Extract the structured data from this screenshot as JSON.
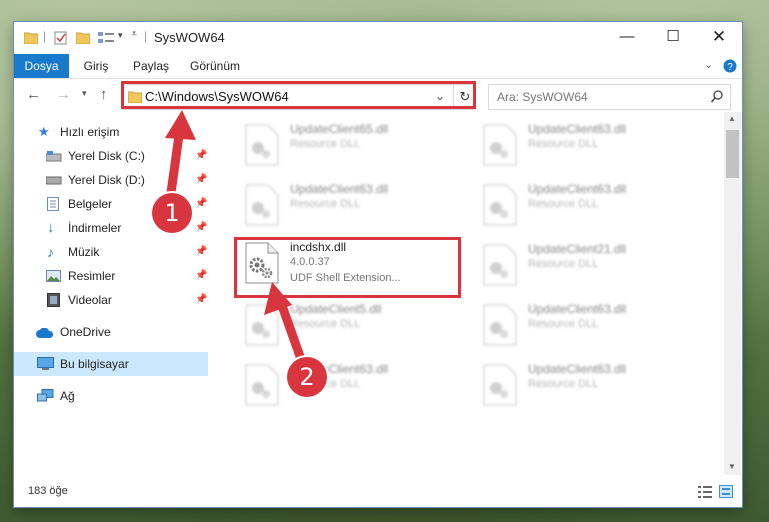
{
  "window": {
    "title": "SysWOW64"
  },
  "ribbon": {
    "tabs": [
      "Dosya",
      "Giriş",
      "Paylaş",
      "Görünüm"
    ]
  },
  "address": {
    "path": "C:\\Windows\\SysWOW64"
  },
  "search": {
    "placeholder": "Ara: SysWOW64"
  },
  "sidebar": {
    "quick_access": "Hızlı erişim",
    "items": [
      "Yerel Disk (C:)",
      "Yerel Disk (D:)",
      "Belgeler",
      "İndirmeler",
      "Müzik",
      "Resimler",
      "Videolar"
    ],
    "onedrive": "OneDrive",
    "this_pc": "Bu bilgisayar",
    "network": "Ağ"
  },
  "files": {
    "left": [
      {
        "name": "UpdateClient65.dll",
        "desc": "Resource DLL"
      },
      {
        "name": "UpdateClient63.dll",
        "desc": "Resource DLL"
      },
      {
        "name": "incdshx.dll",
        "version": "4.0.0.37",
        "desc": "UDF Shell Extension..."
      },
      {
        "name": "UpdateClient5.dll",
        "desc": "Resource DLL"
      },
      {
        "name": "UpdateClient63.dll",
        "desc": "Resource DLL"
      }
    ],
    "right": [
      {
        "name": "UpdateClient63.dll",
        "desc": "Resource DLL"
      },
      {
        "name": "UpdateClient63.dll",
        "desc": "Resource DLL"
      },
      {
        "name": "UpdateClient21.dll",
        "desc": "Resource DLL"
      },
      {
        "name": "UpdateClient63.dll",
        "desc": "Resource DLL"
      },
      {
        "name": "UpdateClient63.dll",
        "desc": "Resource DLL"
      }
    ]
  },
  "status": {
    "count": "183 öğe"
  },
  "annotations": {
    "step1": "1",
    "step2": "2"
  },
  "colors": {
    "accent": "#1979ca",
    "highlight": "#d9353e",
    "selected": "#cce8ff"
  }
}
